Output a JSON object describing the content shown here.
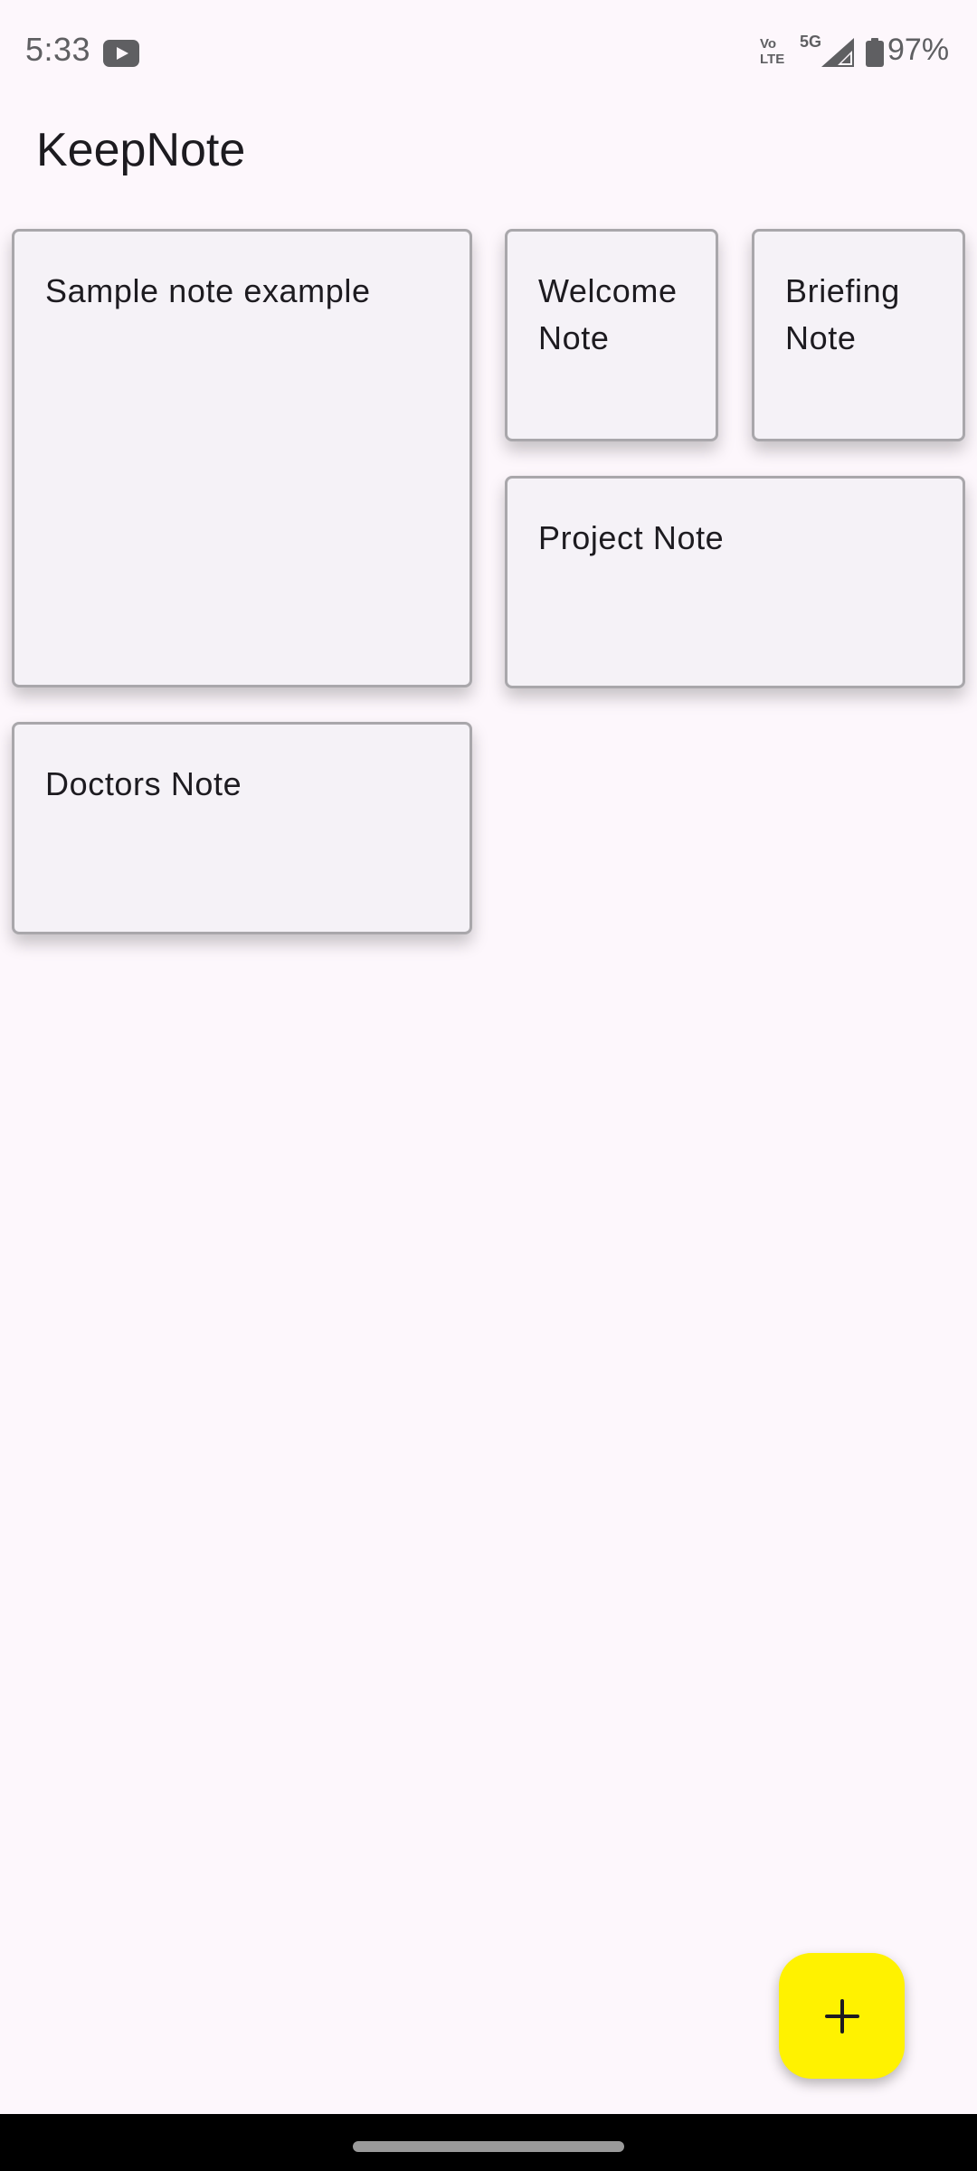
{
  "status_bar": {
    "time": "5:33",
    "network_volte_top": "Vo",
    "network_volte_bottom": "LTE",
    "network_type": "5G",
    "battery_percent": "97%",
    "icons": [
      "youtube-icon",
      "volte-icon",
      "signal-icon",
      "battery-icon"
    ]
  },
  "app_bar": {
    "title": "KeepNote"
  },
  "notes": [
    {
      "title": "Sample note example"
    },
    {
      "title": "Welcome Note"
    },
    {
      "title": "Briefing Note"
    },
    {
      "title": "Project Note"
    },
    {
      "title": "Doctors Note"
    }
  ],
  "fab": {
    "icon": "plus-icon",
    "color": "#fff200"
  },
  "colors": {
    "background": "#fdf7fc",
    "card_background": "#f5f2f7",
    "card_border": "#a9a7ab",
    "text": "#1d1b20",
    "status_text": "#5f5f62"
  }
}
